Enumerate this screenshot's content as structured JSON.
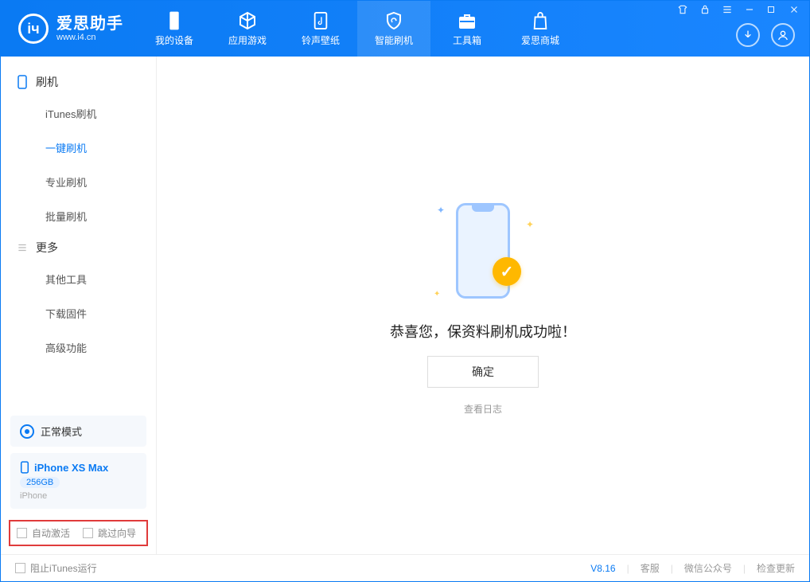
{
  "app": {
    "title": "爱思助手",
    "subtitle": "www.i4.cn"
  },
  "nav": {
    "items": [
      {
        "label": "我的设备"
      },
      {
        "label": "应用游戏"
      },
      {
        "label": "铃声壁纸"
      },
      {
        "label": "智能刷机"
      },
      {
        "label": "工具箱"
      },
      {
        "label": "爱思商城"
      }
    ]
  },
  "sidebar": {
    "flash_section": "刷机",
    "flash_items": [
      {
        "label": "iTunes刷机"
      },
      {
        "label": "一键刷机"
      },
      {
        "label": "专业刷机"
      },
      {
        "label": "批量刷机"
      }
    ],
    "more_section": "更多",
    "more_items": [
      {
        "label": "其他工具"
      },
      {
        "label": "下载固件"
      },
      {
        "label": "高级功能"
      }
    ],
    "mode": "正常模式",
    "device": {
      "name": "iPhone XS Max",
      "capacity": "256GB",
      "type": "iPhone"
    },
    "auto_activate": "自动激活",
    "skip_wizard": "跳过向导"
  },
  "main": {
    "success_msg": "恭喜您，保资料刷机成功啦！",
    "ok_label": "确定",
    "log_link": "查看日志"
  },
  "footer": {
    "block_itunes": "阻止iTunes运行",
    "version": "V8.16",
    "cs": "客服",
    "wechat": "微信公众号",
    "update": "检查更新"
  }
}
